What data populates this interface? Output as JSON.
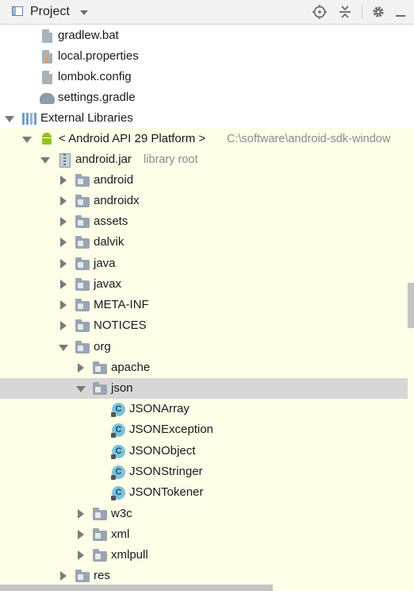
{
  "header": {
    "title": "Project",
    "icons": {
      "view": "window-icon",
      "dropdown": "chevron-down-icon",
      "locate": "crosshair-icon",
      "collapse": "collapse-all-icon",
      "settings": "gear-icon",
      "hide": "hide-icon"
    }
  },
  "rows": [
    {
      "label": "gradlew.bat",
      "icon": "file"
    },
    {
      "label": "local.properties",
      "icon": "properties-file"
    },
    {
      "label": "lombok.config",
      "icon": "file"
    },
    {
      "label": "settings.gradle",
      "icon": "gradle"
    },
    {
      "label": "External Libraries",
      "icon": "library",
      "expanded": true
    },
    {
      "label": "< Android API 29 Platform >",
      "extra": "C:\\software\\android-sdk-window",
      "icon": "android",
      "expanded": true
    },
    {
      "label": "android.jar",
      "extra": "library root",
      "icon": "jar",
      "expanded": true
    },
    {
      "label": "android",
      "icon": "package"
    },
    {
      "label": "androidx",
      "icon": "package"
    },
    {
      "label": "assets",
      "icon": "package"
    },
    {
      "label": "dalvik",
      "icon": "package"
    },
    {
      "label": "java",
      "icon": "package"
    },
    {
      "label": "javax",
      "icon": "package"
    },
    {
      "label": "META-INF",
      "icon": "package"
    },
    {
      "label": "NOTICES",
      "icon": "package"
    },
    {
      "label": "org",
      "icon": "package",
      "expanded": true
    },
    {
      "label": "apache",
      "icon": "package"
    },
    {
      "label": "json",
      "icon": "package",
      "expanded": true,
      "selected": true
    },
    {
      "label": "JSONArray",
      "icon": "class",
      "glyph": "C"
    },
    {
      "label": "JSONException",
      "icon": "class",
      "glyph": "C"
    },
    {
      "label": "JSONObject",
      "icon": "class",
      "glyph": "C"
    },
    {
      "label": "JSONStringer",
      "icon": "class",
      "glyph": "C"
    },
    {
      "label": "JSONTokener",
      "icon": "class",
      "glyph": "C"
    },
    {
      "label": "w3c",
      "icon": "package"
    },
    {
      "label": "xml",
      "icon": "package"
    },
    {
      "label": "xmlpull",
      "icon": "package"
    },
    {
      "label": "res",
      "icon": "package"
    }
  ],
  "colors": {
    "selection": "#d7d7d7",
    "library_bg": "#fdfde8",
    "class_icon": "#7dc3dc",
    "android": "#95c11f"
  }
}
